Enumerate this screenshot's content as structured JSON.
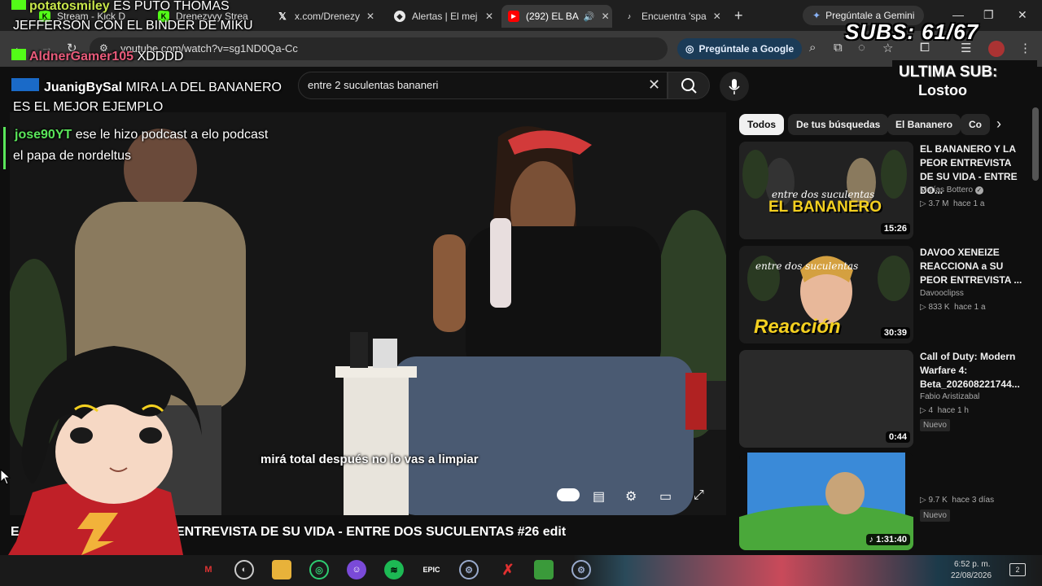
{
  "browser": {
    "tabs": [
      {
        "label": "Stream - Kick D",
        "favicon": "kick-icon",
        "color": "#53fc18",
        "active": false
      },
      {
        "label": "Drenezyyy Strea",
        "favicon": "kick-icon",
        "color": "#53fc18",
        "active": false
      },
      {
        "label": "x.com/Drenezy",
        "favicon": "x-icon",
        "color": "#ffffff",
        "active": false
      },
      {
        "label": "Alertas | El mej",
        "favicon": "alert-icon",
        "color": "#e8e8e8",
        "active": false
      },
      {
        "label": "(292) EL BA",
        "favicon": "youtube-icon",
        "color": "#ff0000",
        "active": true
      },
      {
        "label": "Encuentra 'spa",
        "favicon": "tiktok-icon",
        "color": "#ffffff",
        "active": false
      }
    ],
    "gemini_label": "Pregúntale a Gemini",
    "url": "youtube.com/watch?v=sg1ND0Qa-Cc",
    "ask_google_label": "Pregúntale a Google"
  },
  "youtube": {
    "search_value": "entre 2 suculentas bananeri",
    "video": {
      "subtitle": "mirá total después no lo vas a limpiar",
      "title_visible": "ENTREVISTA DE SU VIDA - ENTRE DOS SUCULENTAS #26 edit",
      "title_prefix": "E"
    },
    "chips": [
      "Todos",
      "De tus búsquedas",
      "El Bananero",
      "Co"
    ],
    "recommendations": [
      {
        "title": "EL BANANERO Y LA PEOR ENTREVISTA DE SU VIDA - ENTRE DO...",
        "channel": "Matías Bottero",
        "verified": true,
        "views": "3.7 M",
        "age": "hace 1 a",
        "duration": "15:26",
        "thumb_text": "EL BANANERO",
        "thumb_sub": "entre dos suculentas",
        "is_new": false
      },
      {
        "title": "DAVOO XENEIZE REACCIONA a SU PEOR ENTREVISTA ...",
        "channel": "Davooclipss",
        "verified": false,
        "views": "833 K",
        "age": "hace 1 a",
        "duration": "30:39",
        "thumb_text": "Reacción",
        "thumb_sub": "entre dos suculentas",
        "is_new": false
      },
      {
        "title": "Call of Duty: Modern Warfare 4: Beta_202608221744...",
        "channel": "Fabio Aristizabal",
        "verified": false,
        "views": "4",
        "age": "hace 1 h",
        "duration": "0:44",
        "thumb_text": "",
        "thumb_sub": "",
        "is_new": true
      },
      {
        "title": "",
        "channel": "",
        "verified": false,
        "views": "9.7 K",
        "age": "hace 3 días",
        "duration": "1:31:40",
        "thumb_text": "",
        "thumb_sub": "",
        "is_new": true
      }
    ],
    "new_badge": "Nuevo"
  },
  "overlay": {
    "subs_text": "SUBS: 61/67",
    "last_sub_label": "ULTIMA SUB:",
    "last_sub_name": "Lostoo",
    "chat": [
      {
        "user": "potatosmiley",
        "message": "ES PUTO THOMAS",
        "user_color": "#c8e64a"
      },
      {
        "user": "",
        "message": "JEFFERSON CON EL BINDER DE MIKU",
        "user_color": "#ffffff"
      },
      {
        "user": "AldnerGamer105",
        "message": "XDDDD",
        "user_color": "#e85a7a"
      },
      {
        "user": "JuanigBySal",
        "message": "MIRA LA DEL BANANERO",
        "user_color": "#ffffff"
      },
      {
        "user": "",
        "message": "ES EL MEJOR EJEMPLO",
        "user_color": "#ffffff"
      },
      {
        "user": "jose90YT",
        "message": "ese le hizo podcast a elo podcast",
        "user_color": "#5ae65a"
      },
      {
        "user": "",
        "message": "el papa de nordeltus",
        "user_color": "#ffffff"
      }
    ]
  },
  "taskbar": {
    "time": "6:52 p. m.",
    "date": "22/08/2026",
    "notifications": "2"
  }
}
